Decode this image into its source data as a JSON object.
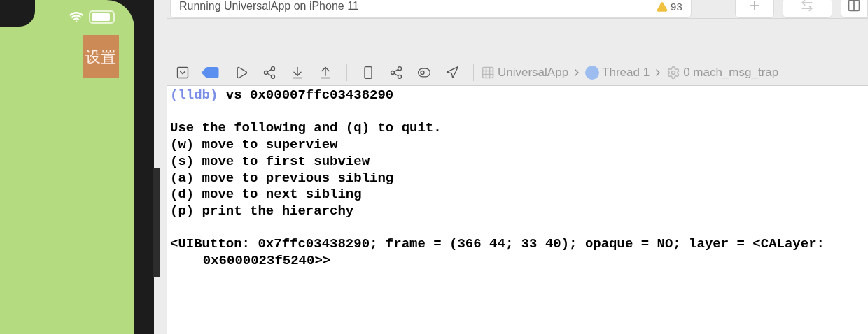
{
  "simulator": {
    "button": "设置"
  },
  "toolbar": {
    "activity": "Running UniversalApp on iPhone 11",
    "warnings": "93"
  },
  "debug_bar": {
    "breakpoints_active": true,
    "breadcrumbs": [
      "UniversalApp",
      "Thread 1",
      "0 mach_msg_trap"
    ]
  },
  "console": {
    "prompt": "(lldb)",
    "command": "vs 0x00007ffc03438290",
    "blocks": [
      [
        "Use the following and (q) to quit.",
        "(w) move to superview",
        "(s) move to first subview",
        "(a) move to previous sibling",
        "(d) move to next sibling",
        "(p) print the hierarchy"
      ],
      [
        "<UIButton: 0x7ffc03438290; frame = (366 44; 33 40); opaque = NO; layer = <CALayer: 0x6000023f5240>>"
      ]
    ]
  }
}
